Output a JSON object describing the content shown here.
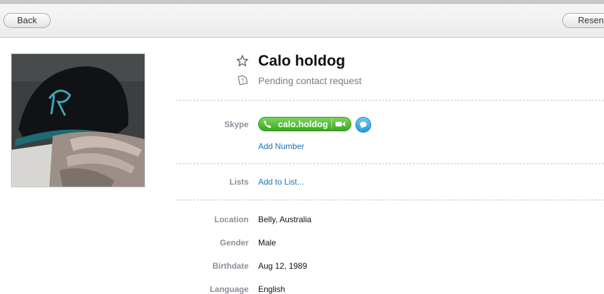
{
  "toolbar": {
    "back_label": "Back",
    "resend_label": "Resend"
  },
  "profile": {
    "name": "Calo holdog",
    "status": "Pending contact request"
  },
  "skype": {
    "label": "Skype",
    "handle": "calo.holdog",
    "add_number": "Add Number"
  },
  "lists": {
    "label": "Lists",
    "add_to_list": "Add to List..."
  },
  "details": [
    {
      "label": "Location",
      "value": "Belly, Australia"
    },
    {
      "label": "Gender",
      "value": "Male"
    },
    {
      "label": "Birthdate",
      "value": "Aug 12, 1989"
    },
    {
      "label": "Language",
      "value": "English"
    }
  ],
  "colors": {
    "call_green": "#39a81f",
    "link_blue": "#1a73b4",
    "chat_blue": "#239ad9"
  }
}
